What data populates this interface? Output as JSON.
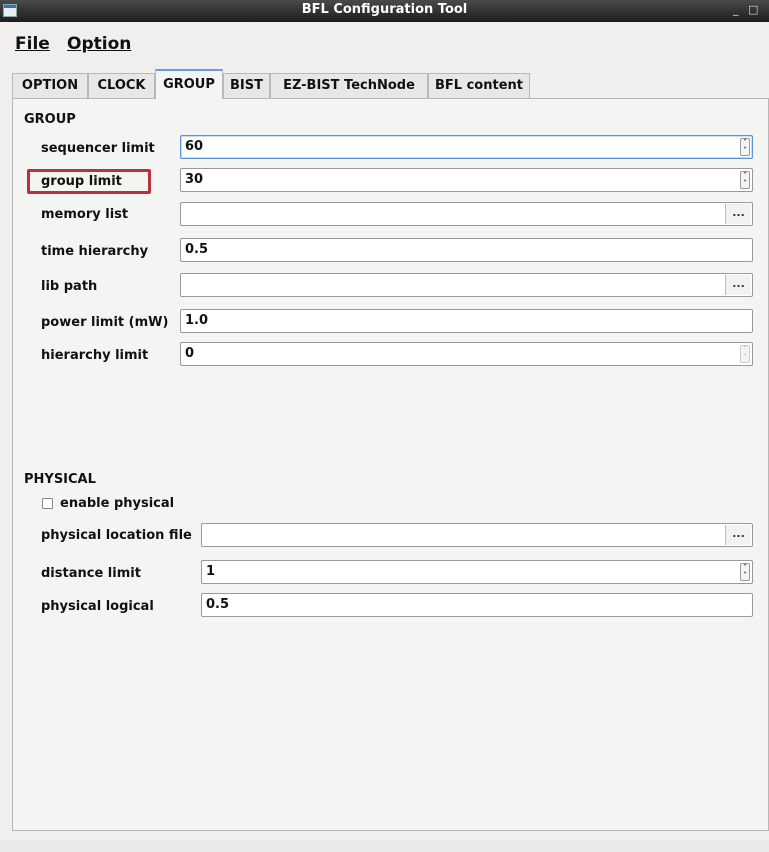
{
  "window": {
    "title": "BFL Configuration Tool",
    "minimize_glyph": "_",
    "maximize_glyph": "□"
  },
  "menu": {
    "file": "File",
    "option": "Option"
  },
  "tabs": [
    "OPTION",
    "CLOCK",
    "GROUP",
    "BIST",
    "EZ-BIST TechNode",
    "BFL content"
  ],
  "active_tab": "GROUP",
  "group": {
    "title": "GROUP",
    "sequencer_limit": {
      "label": "sequencer limit",
      "value": "60"
    },
    "group_limit": {
      "label": "group limit",
      "value": "30"
    },
    "memory_list": {
      "label": "memory list",
      "value": "",
      "browse": "..."
    },
    "time_hierarchy": {
      "label": "time hierarchy",
      "value": "0.5"
    },
    "lib_path": {
      "label": "lib path",
      "value": "",
      "browse": "..."
    },
    "power_limit": {
      "label": "power limit (mW)",
      "value": "1.0"
    },
    "hierarchy_limit": {
      "label": "hierarchy limit",
      "value": "0"
    }
  },
  "physical": {
    "title": "PHYSICAL",
    "enable_physical": {
      "label": "enable physical",
      "checked": false
    },
    "physical_location_file": {
      "label": "physical location file",
      "value": "",
      "browse": "..."
    },
    "distance_limit": {
      "label": "distance limit",
      "value": "1"
    },
    "physical_logical": {
      "label": "physical logical",
      "value": "0.5"
    }
  },
  "icons": {
    "spin_up": "spin-up-icon",
    "spin_down": "spin-down-icon",
    "browse": "ellipsis-icon",
    "checkbox": "checkbox-icon",
    "app": "app-window-icon"
  },
  "colors": {
    "highlight": "#b7323a",
    "active_tab": "#6a9ed8",
    "focus": "#5b93d4"
  }
}
